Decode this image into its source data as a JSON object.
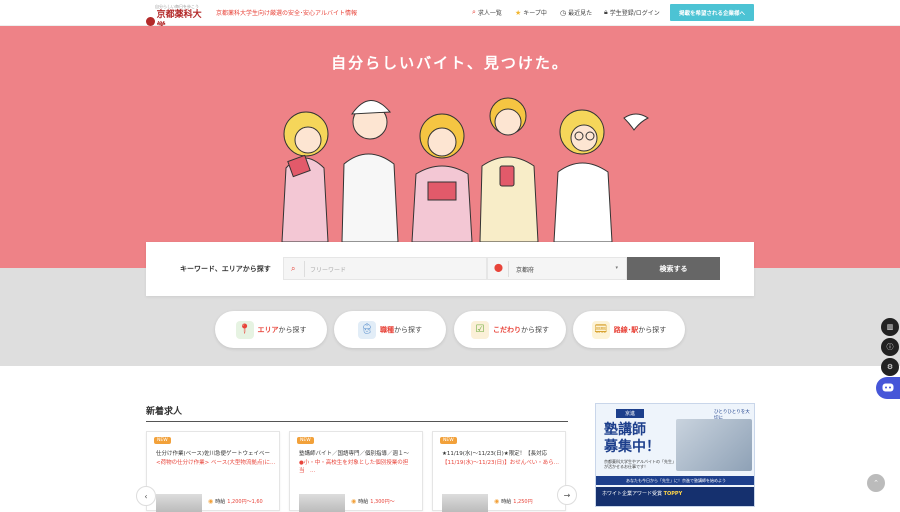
{
  "header": {
    "logo_small": "自分らしい毎日を歩こう",
    "logo_text": "京都薬科大学",
    "tagline": "京都薬科大学生向け厳選の安全･安心アルバイト情報",
    "nav": [
      {
        "icon": "search-icon",
        "label": "求人一覧"
      },
      {
        "icon": "star-icon",
        "label": "キープ中"
      },
      {
        "icon": "clock-icon",
        "label": "最近見た"
      },
      {
        "icon": "lock-icon",
        "label": "学生登録/ログイン"
      }
    ],
    "cta_label": "掲載を希望される企業様へ"
  },
  "hero": {
    "title": "自分らしいバイト、見つけた。",
    "bg_color": "#ee8287"
  },
  "search": {
    "label": "キーワード、エリアから探す",
    "keyword_placeholder": "フリーワード",
    "prefecture_value": "京都府",
    "button_label": "検索する"
  },
  "categories": [
    {
      "highlight": "エリア",
      "suffix": "から探す",
      "icon": "map-pin-icon"
    },
    {
      "highlight": "職種",
      "suffix": "から探す",
      "icon": "worker-icon"
    },
    {
      "highlight": "こだわり",
      "suffix": "から探す",
      "icon": "checklist-icon"
    },
    {
      "highlight": "路線･駅",
      "suffix": "から探す",
      "icon": "train-icon"
    }
  ],
  "new_jobs": {
    "title": "新着求人",
    "cards": [
      {
        "badge": "NEW",
        "line1": "仕分け作業(ベース)佐川急便ゲートウェイベー",
        "line2": "<荷物の仕分け作業> ベース(大型物流拠点)に...",
        "wage_label": "時給",
        "wage": "1,200円～1,60"
      },
      {
        "badge": "NEW",
        "line1": "塾講師バイト／国語専門／個別指導／週１～",
        "line2": "●小・中・高校生を対象とした個別授業の担当　...",
        "wage_label": "時給",
        "wage": "1,300円～"
      },
      {
        "badge": "NEW",
        "line1": "★11/19(水)～11/23(日)★限定！【長対応",
        "line2": "【11/19(水)～11/23(日)】おせんべい・あら...",
        "wage_label": "時給",
        "wage": "1,250円"
      }
    ]
  },
  "ad": {
    "brand": "京進",
    "side_text": "ひとりひとりを大切に",
    "headline_1": "塾講師",
    "headline_2": "募集中！",
    "desc": "京都薬科大学生やアルバイトの「先生」が活かせるお仕事です！",
    "strip": "あなたも今日から「先生」に！京進で塾講師を始めよう",
    "award_1": "ホワイト企業アワード受賞",
    "award_2": "TOPPY"
  },
  "side_buttons": [
    "book-icon",
    "info-icon",
    "settings-icon"
  ]
}
